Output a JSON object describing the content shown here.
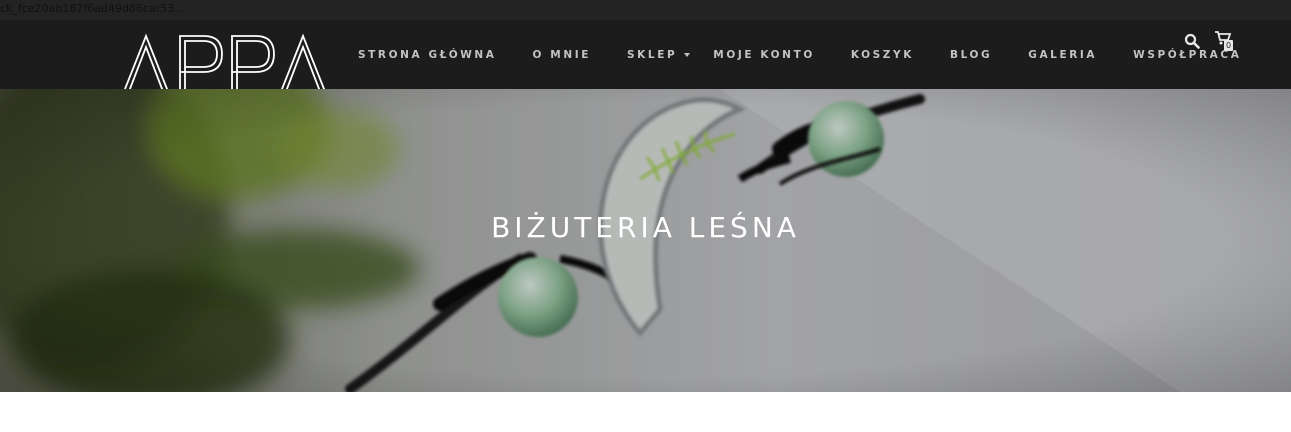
{
  "browser": {
    "url_fragment": "ck_fce20ab187f6ad49d86car53..."
  },
  "brand": {
    "logo_text": "APPA"
  },
  "nav": {
    "items": [
      {
        "label": "STRONA GŁÓWNA"
      },
      {
        "label": "O MNIE"
      },
      {
        "label": "SKLEP",
        "has_dropdown": true
      },
      {
        "label": "MOJE KONTO"
      },
      {
        "label": "KOSZYK"
      },
      {
        "label": "BLOG"
      },
      {
        "label": "GALERIA"
      },
      {
        "label": "WSPÓŁPRACA"
      }
    ]
  },
  "header_icons": {
    "search": "search-icon",
    "cart": "cart-icon",
    "cart_count": "0"
  },
  "hero": {
    "title": "BIŻUTERIA LEŚNA"
  },
  "colors": {
    "navbar_bg": "#1c1c1c",
    "nav_text": "#c3c3c3",
    "hero_title": "#ffffff"
  }
}
